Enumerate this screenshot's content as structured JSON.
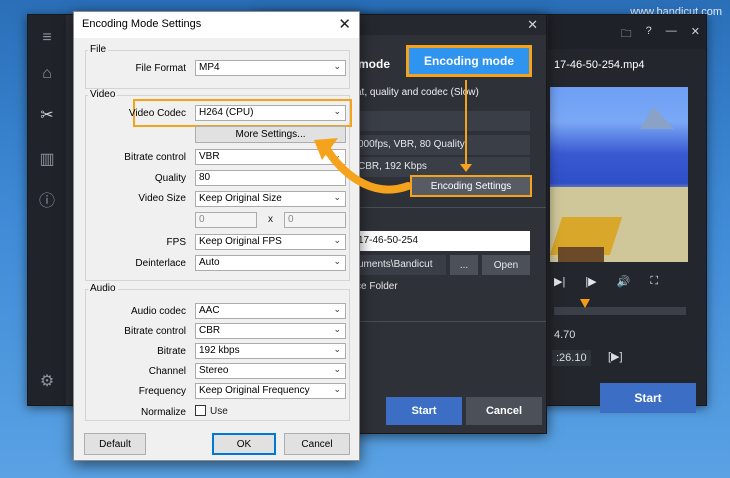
{
  "watermark": "www.bandicut.com",
  "main_window": {
    "file_title": "17-46-50-254.mp4",
    "time_current": "4.70",
    "time_end": ":26.10",
    "bracket_symbol": "[▶]",
    "start_label": "Start",
    "window_icons": [
      "folder-icon",
      "help-icon",
      "minimize-icon",
      "close-icon"
    ],
    "title_icons": [
      "🗀",
      "?",
      "—",
      "✕"
    ],
    "controls": [
      "▶|",
      "|▶",
      "🔊",
      "⛶"
    ]
  },
  "encode_dialog": {
    "mode_label": "mode",
    "encoding_mode_button": "Encoding mode",
    "description": "at, quality and codec (Slow)",
    "video_info": "000fps, VBR, 80 Quality",
    "audio_info": "CBR, 192 Kbps",
    "encoding_settings_button": "Encoding Settings",
    "filename": "17-46-50-254",
    "path": "uments\\Bandicut",
    "dots_button": "...",
    "open_button": "Open",
    "source_folder": "ce Folder",
    "start_button": "Start",
    "cancel_button": "Cancel"
  },
  "front_dialog": {
    "title": "Encoding Mode Settings",
    "close": "✕",
    "groups": {
      "file": "File",
      "video": "Video",
      "audio": "Audio"
    },
    "file_format": {
      "label": "File Format",
      "value": "MP4"
    },
    "video_codec": {
      "label": "Video Codec",
      "value": "H264 (CPU)"
    },
    "more_settings": "More Settings...",
    "bitrate_control": {
      "label": "Bitrate control",
      "value": "VBR"
    },
    "quality": {
      "label": "Quality",
      "value": "80"
    },
    "video_size": {
      "label": "Video Size",
      "value": "Keep Original Size",
      "width": "0",
      "x": "x",
      "height": "0"
    },
    "fps": {
      "label": "FPS",
      "value": "Keep Original FPS"
    },
    "deinterlace": {
      "label": "Deinterlace",
      "value": "Auto"
    },
    "audio_codec": {
      "label": "Audio codec",
      "value": "AAC"
    },
    "audio_bitrate_control": {
      "label": "Bitrate control",
      "value": "CBR"
    },
    "bitrate": {
      "label": "Bitrate",
      "value": "192 kbps"
    },
    "channel": {
      "label": "Channel",
      "value": "Stereo"
    },
    "frequency": {
      "label": "Frequency",
      "value": "Keep Original Frequency"
    },
    "normalize": {
      "label": "Normalize",
      "checkbox_label": "Use",
      "checked": false
    },
    "default_button": "Default",
    "ok_button": "OK",
    "cancel_button": "Cancel"
  },
  "colors": {
    "accent_orange": "#f5a21d",
    "accent_blue": "#2f93f0",
    "start_blue": "#3b6ec4"
  }
}
